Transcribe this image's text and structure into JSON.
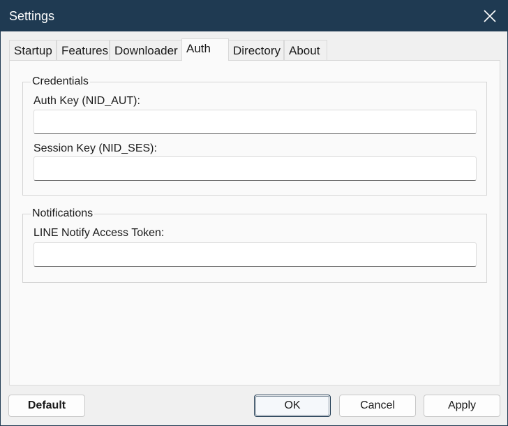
{
  "window": {
    "title": "Settings"
  },
  "tabs": [
    {
      "label": "Startup",
      "active": false
    },
    {
      "label": "Features",
      "active": false
    },
    {
      "label": "Downloader",
      "active": false
    },
    {
      "label": "Auth",
      "active": true
    },
    {
      "label": "Directory",
      "active": false
    },
    {
      "label": "About",
      "active": false
    }
  ],
  "credentials": {
    "legend": "Credentials",
    "auth_key": {
      "label": "Auth Key (NID_AUT):",
      "value": "",
      "placeholder": ""
    },
    "session_key": {
      "label": "Session Key (NID_SES):",
      "value": "",
      "placeholder": ""
    }
  },
  "notifications": {
    "legend": "Notifications",
    "line_token": {
      "label": "LINE Notify Access Token:",
      "value": "",
      "placeholder": ""
    }
  },
  "buttons": {
    "default_label": "Default",
    "ok_label": "OK",
    "cancel_label": "Cancel",
    "apply_label": "Apply"
  },
  "colors": {
    "titlebar": "#1f3a52",
    "window_bg": "#f0f0f0",
    "panel_bg": "#fafafa"
  },
  "icons": {
    "close": "close-icon"
  }
}
